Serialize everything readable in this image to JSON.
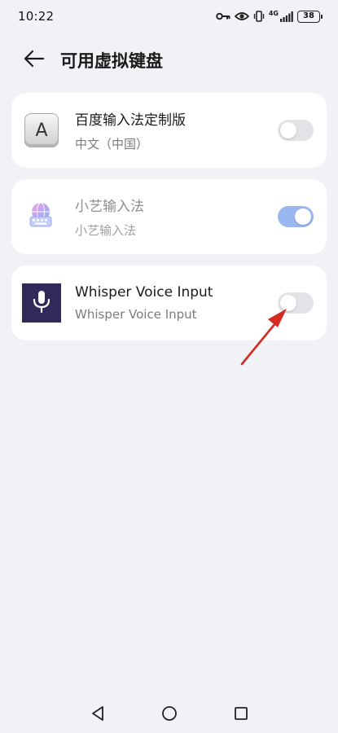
{
  "status_bar": {
    "time": "10:22",
    "network": "4G",
    "battery": "38"
  },
  "header": {
    "title": "可用虚拟键盘"
  },
  "keyboards": [
    {
      "name": "百度输入法定制版",
      "subtitle": "中文（中国）",
      "enabled": false,
      "icon": "keyboard-key-icon"
    },
    {
      "name": "小艺输入法",
      "subtitle": "小艺输入法",
      "enabled": true,
      "icon": "xiaoyi-globe-icon"
    },
    {
      "name": "Whisper Voice Input",
      "subtitle": "Whisper Voice Input",
      "enabled": false,
      "icon": "microphone-icon"
    }
  ],
  "colors": {
    "background": "#f1f2f6",
    "card": "#ffffff",
    "toggle_on": "#9bb7f2",
    "toggle_off": "#e3e4e8",
    "annotation_arrow": "#e0201e",
    "whisper_icon_bg": "#2f2a57"
  }
}
